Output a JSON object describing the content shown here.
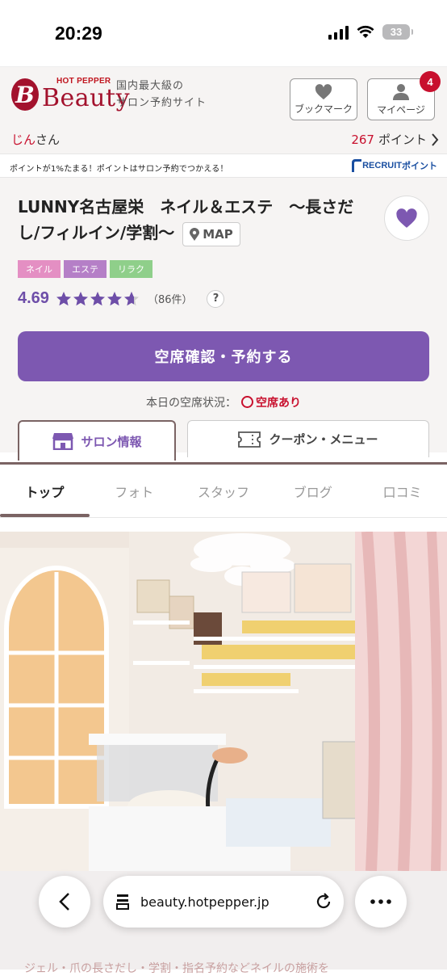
{
  "status_bar": {
    "time": "20:29",
    "battery": "33"
  },
  "header": {
    "logo_hotpepper": "HOT PEPPER",
    "logo_beauty": "Beauty",
    "logo_b": "B",
    "tagline_1": "国内最大級の",
    "tagline_2": "サロン予約サイト",
    "bookmark_label": "ブックマーク",
    "mypage_label": "マイページ",
    "mypage_badge": "4"
  },
  "user": {
    "name_red": "じん",
    "name_suffix": "さん",
    "points_num": "267",
    "points_label": "ポイント"
  },
  "infobar": {
    "message": "ポイントが1%たまる！ポイントはサロン予約でつかえる！",
    "recruit": "RECRUIT",
    "recruit_point": "ポイント"
  },
  "salon": {
    "name": "LUNNY名古屋栄　ネイル＆エステ　～長さだし/フィルイン/学割～",
    "map_label": "MAP",
    "tags": [
      {
        "label": "ネイル",
        "color": "#e48fc3"
      },
      {
        "label": "エステ",
        "color": "#b57fc7"
      },
      {
        "label": "リラク",
        "color": "#8fcf8a"
      }
    ],
    "rating": "4.69",
    "review_count": "（86件）",
    "help": "?",
    "reserve_label": "空席確認・予約する",
    "availability_label": "本日の空席状況：",
    "availability_status": "空席あり"
  },
  "tabs": {
    "salon_info": "サロン情報",
    "coupon_menu": "クーポン・メニュー"
  },
  "subnav": [
    "トップ",
    "フォト",
    "スタッフ",
    "ブログ",
    "口コミ"
  ],
  "photo": {
    "description": "nail salon interior"
  },
  "safari": {
    "url": "beauty.hotpepper.jp"
  },
  "bottom_text": "ジェル・爪の長さだし・学割・指名予約などネイルの施術を"
}
